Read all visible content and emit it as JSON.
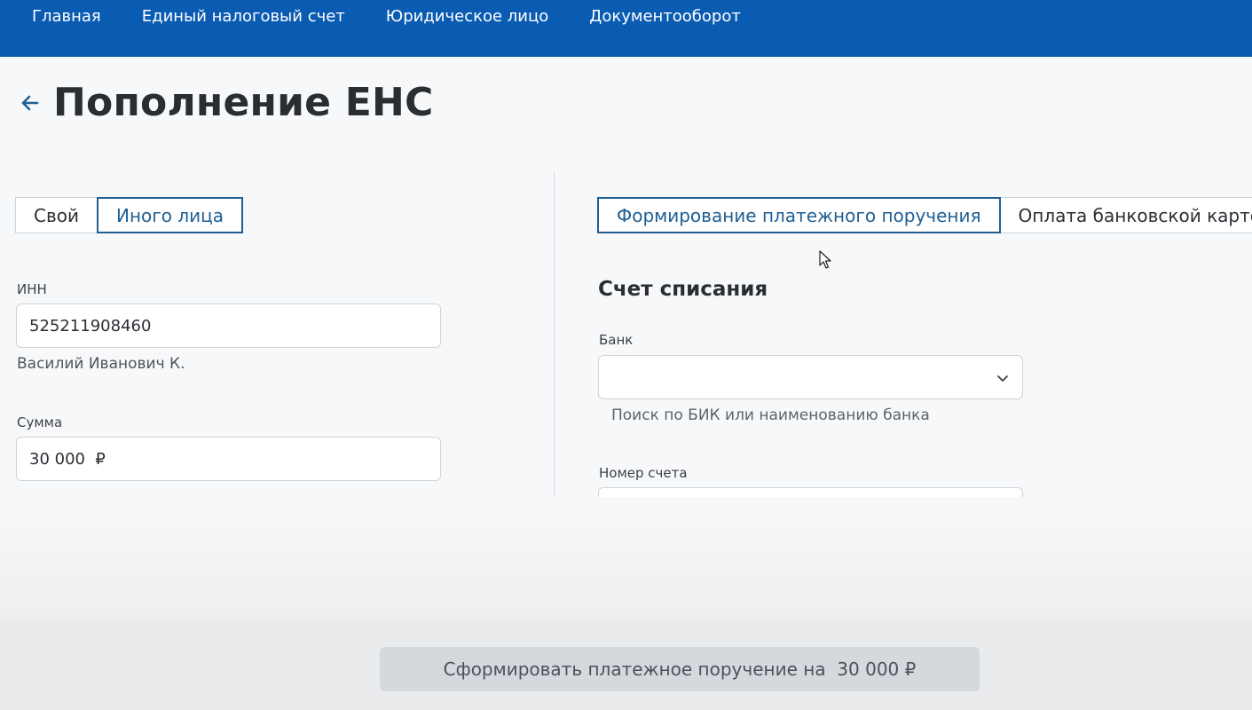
{
  "nav": {
    "items": [
      {
        "label": "Главная"
      },
      {
        "label": "Единый налоговый счет"
      },
      {
        "label": "Юридическое лицо"
      },
      {
        "label": "Документооборот"
      }
    ]
  },
  "header": {
    "back_icon": "arrow-left-icon",
    "title": "Пополнение ЕНС"
  },
  "payer_toggle": {
    "options": [
      {
        "label": "Свой",
        "active": false
      },
      {
        "label": "Иного лица",
        "active": true
      }
    ]
  },
  "inn": {
    "label": "ИНН",
    "value": "525211908460",
    "owner": "Василий Иванович К."
  },
  "amount": {
    "label": "Сумма",
    "value": "30 000  ₽"
  },
  "payment_method": {
    "options": [
      {
        "label": "Формирование платежного поручения",
        "active": true
      },
      {
        "label": "Оплата банковской картой",
        "active": false
      }
    ]
  },
  "debit_account": {
    "heading": "Счет списания",
    "bank_label": "Банк",
    "bank_value": "",
    "bank_hint": "Поиск по БИК или наименованию банка",
    "account_label": "Номер счета",
    "account_value": ""
  },
  "submit": {
    "label": "Сформировать платежное поручение на  30 000 ₽"
  },
  "colors": {
    "topbar": "#0a5bb2",
    "accent": "#1f5f94"
  }
}
